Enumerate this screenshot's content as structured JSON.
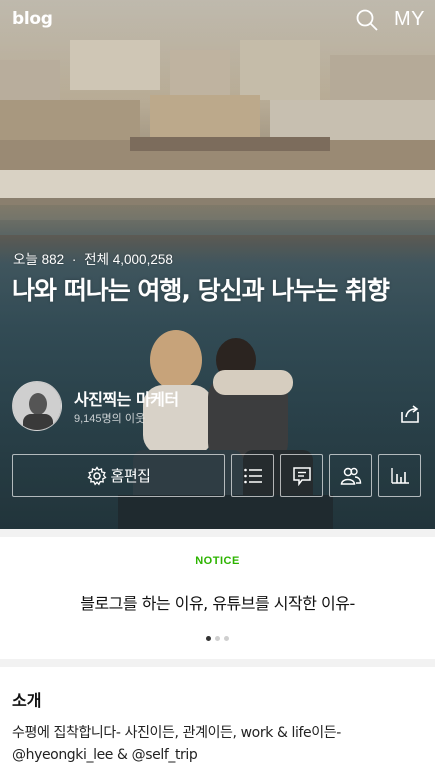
{
  "header": {
    "logo": "blog",
    "my_label": "MY",
    "search_icon": "search-icon"
  },
  "stats": {
    "today_label": "오늘",
    "today_count": "882",
    "separator": "·",
    "total_label": "전체",
    "total_count": "4,000,258"
  },
  "blog": {
    "title": "나와 떠나는 여행, 당신과 나누는 취향",
    "blogger_name": "사진찍는 마케터",
    "neighbor_text": "9,145명의 이웃"
  },
  "actions": {
    "home_edit_label": "홈편집",
    "home_edit_icon": "gear-icon",
    "icons": [
      "list-icon",
      "comment-icon",
      "neighbors-icon",
      "stats-icon"
    ]
  },
  "notice": {
    "label": "NOTICE",
    "text": "블로그를 하는 이유, 유튜브를 시작한 이유-",
    "dots_total": 3,
    "dots_active": 1
  },
  "intro": {
    "heading": "소개",
    "line1": "수평에 집착합니다- 사진이든, 관계이든, work & life이든-",
    "line2": "@hyeongki_lee & @self_trip"
  },
  "colors": {
    "notice_accent": "#2db400",
    "text_dark": "#111111"
  }
}
